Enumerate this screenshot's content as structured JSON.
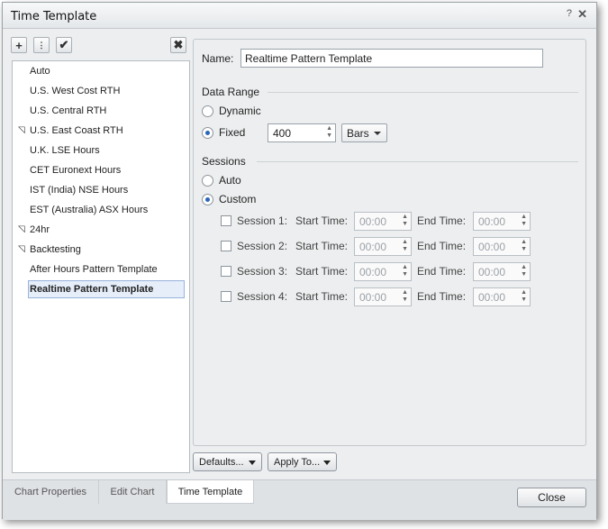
{
  "window": {
    "title": "Time Template",
    "help": "?",
    "close": "✕"
  },
  "toolbar": {
    "add": "+",
    "add_child": "⋮",
    "apply": "✔",
    "delete": "✖"
  },
  "list": {
    "items": [
      {
        "label": "Auto",
        "tri": ""
      },
      {
        "label": "U.S. West Cost RTH",
        "tri": ""
      },
      {
        "label": "U.S. Central RTH",
        "tri": ""
      },
      {
        "label": "U.S. East Coast RTH",
        "tri": "◹"
      },
      {
        "label": "U.K. LSE Hours",
        "tri": ""
      },
      {
        "label": "CET Euronext Hours",
        "tri": ""
      },
      {
        "label": "IST (India) NSE Hours",
        "tri": ""
      },
      {
        "label": "EST (Australia) ASX Hours",
        "tri": ""
      },
      {
        "label": "24hr",
        "tri": "◹"
      },
      {
        "label": "Backtesting",
        "tri": "◹"
      },
      {
        "label": "After Hours Pattern Template",
        "tri": ""
      },
      {
        "label": "Realtime Pattern Template",
        "tri": ""
      }
    ]
  },
  "form": {
    "name_label": "Name:",
    "name_value": "Realtime Pattern Template",
    "data_range": "Data Range",
    "dynamic": "Dynamic",
    "fixed": "Fixed",
    "fixed_value": "400",
    "bars": "Bars",
    "sessions": "Sessions",
    "auto": "Auto",
    "custom": "Custom",
    "start_time": "Start Time:",
    "end_time": "End Time:",
    "session_rows": [
      {
        "label": "Session 1:",
        "start": "00:00",
        "end": "00:00"
      },
      {
        "label": "Session 2:",
        "start": "00:00",
        "end": "00:00"
      },
      {
        "label": "Session 3:",
        "start": "00:00",
        "end": "00:00"
      },
      {
        "label": "Session 4:",
        "start": "00:00",
        "end": "00:00"
      }
    ]
  },
  "buttons": {
    "defaults": "Defaults...",
    "apply_to": "Apply To...",
    "close": "Close"
  },
  "tabs": [
    {
      "label": "Chart Properties"
    },
    {
      "label": "Edit Chart"
    },
    {
      "label": "Time Template"
    }
  ]
}
